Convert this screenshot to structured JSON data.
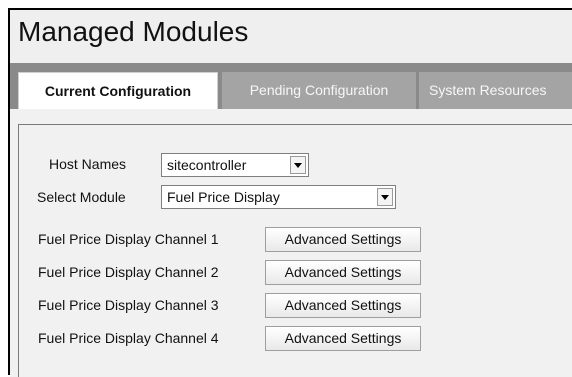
{
  "page": {
    "title": "Managed Modules"
  },
  "tabs": [
    {
      "label": "Current Configuration",
      "active": true
    },
    {
      "label": "Pending Configuration",
      "active": false
    },
    {
      "label": "System Resources",
      "active": false
    }
  ],
  "form": {
    "host_names": {
      "label": "Host Names",
      "value": "sitecontroller"
    },
    "select_module": {
      "label": "Select Module",
      "value": "Fuel Price Display"
    }
  },
  "channels": [
    {
      "label": "Fuel Price Display Channel 1",
      "button": "Advanced Settings"
    },
    {
      "label": "Fuel Price Display Channel 2",
      "button": "Advanced Settings"
    },
    {
      "label": "Fuel Price Display Channel 3",
      "button": "Advanced Settings"
    },
    {
      "label": "Fuel Price Display Channel 4",
      "button": "Advanced Settings"
    }
  ],
  "colors": {
    "tab_strip": "#8a8a8a",
    "tab_inactive": "#a4a4a4",
    "panel_bg": "#f1f1f1"
  },
  "icons": {
    "dropdown": "chevron-down-icon"
  }
}
